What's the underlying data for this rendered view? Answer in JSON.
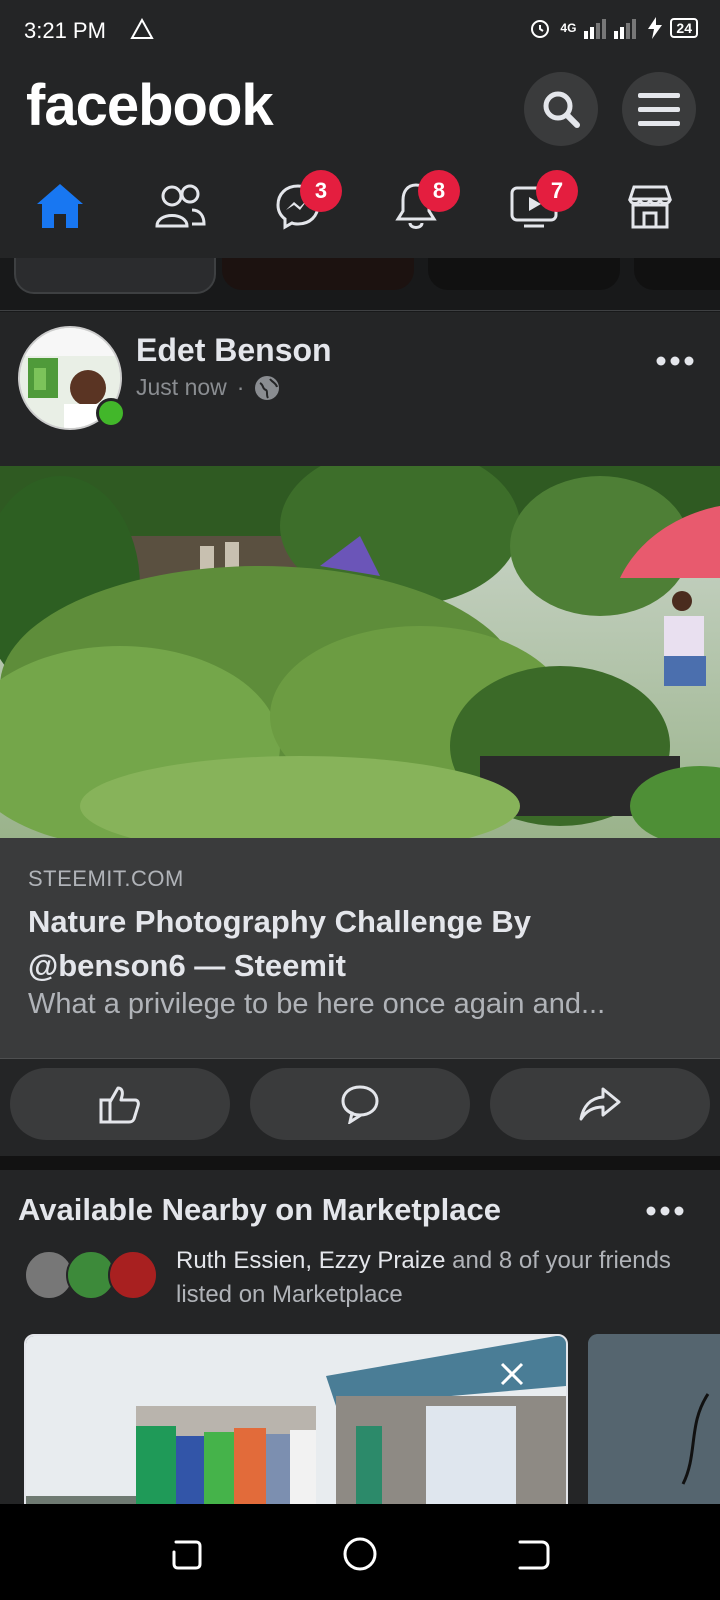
{
  "status_bar": {
    "time": "3:21 PM",
    "network": "4G",
    "battery": "24"
  },
  "header": {
    "logo": "facebook"
  },
  "tabs": {
    "home": {
      "icon": "home-icon"
    },
    "friends": {
      "icon": "friends-icon"
    },
    "messenger": {
      "icon": "messenger-icon",
      "badge": "3"
    },
    "notifications": {
      "icon": "bell-icon",
      "badge": "8"
    },
    "watch": {
      "icon": "watch-icon",
      "badge": "7"
    },
    "marketplace": {
      "icon": "marketplace-icon"
    }
  },
  "post": {
    "author": "Edet Benson",
    "time": "Just now",
    "privacy_icon": "globe-icon",
    "link": {
      "domain": "STEEMIT.COM",
      "title": "Nature Photography Challenge By @benson6 — Steemit",
      "description": "What a privilege to be here once again and..."
    }
  },
  "marketplace": {
    "title": "Available Nearby on Marketplace",
    "friend1": "Ruth Essien",
    "sep": ", ",
    "friend2": "Ezzy Praize",
    "suffix": " and 8 of your friends listed on Marketplace"
  },
  "colors": {
    "accent": "#1877f2",
    "badge": "#e41e3f",
    "online": "#42b72a",
    "background": "#18191a",
    "surface": "#242526"
  }
}
